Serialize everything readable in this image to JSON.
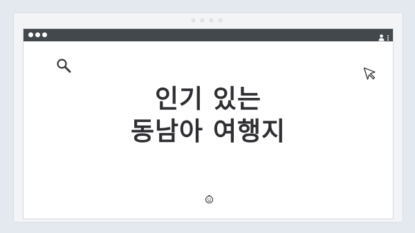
{
  "headline": {
    "line1": "인기 있는",
    "line2": "동남아 여행지"
  },
  "icons": {
    "search": "search-icon",
    "cursor": "cursor-arrow-icon",
    "emoji": "smiley-face-icon",
    "user": "user-icon",
    "menu": "kebab-menu-icon"
  },
  "colors": {
    "background": "#e4e9ef",
    "titlebar": "#43484d",
    "text": "#2f2f33"
  }
}
